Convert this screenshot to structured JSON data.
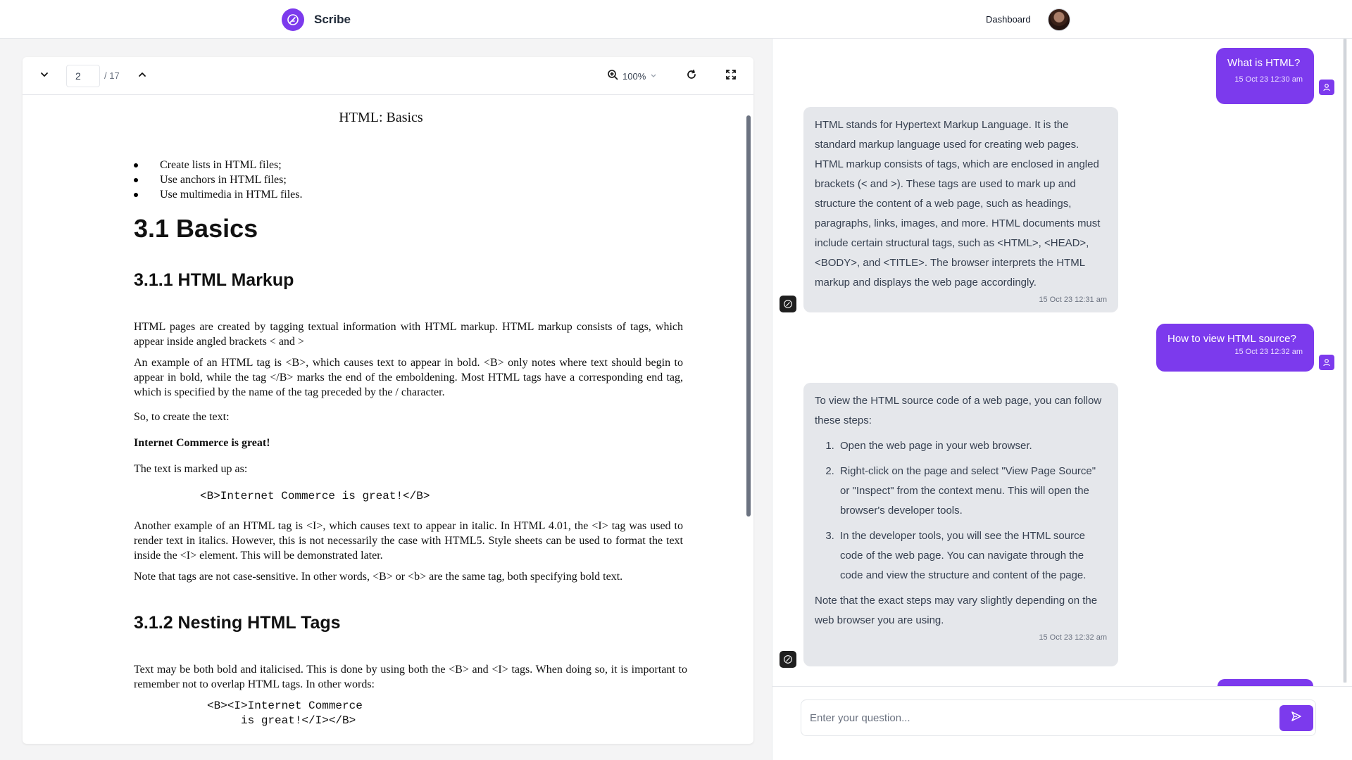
{
  "app": {
    "name": "Scribe"
  },
  "nav": {
    "dashboard_label": "Dashboard"
  },
  "viewer": {
    "page_current": "2",
    "page_total": "/ 17",
    "zoom": "100%"
  },
  "document": {
    "running_title": "HTML: Basics",
    "bullets": [
      "Create lists in HTML files;",
      "Use anchors in HTML files;",
      "Use multimedia in HTML files."
    ],
    "h1": "3.1  Basics",
    "h2_markup": "3.1.1 HTML Markup",
    "p1": "HTML pages are created by tagging textual information with HTML markup. HTML markup consists of tags, which appear inside angled brackets < and >",
    "p2": "An example of an HTML tag is <B>, which causes text to appear in bold. <B> only notes where text should begin to appear in bold, while the tag </B> marks the end of the emboldening. Most HTML tags have a corresponding end tag, which is specified by the name of the tag preceded by the / character.",
    "p3": "So, to create the  text:",
    "p4": "Internet Commerce is great!",
    "p5": "The text is marked up as:",
    "code1": "<B>Internet Commerce is great!</B>",
    "p6": "Another example of an HTML tag is <I>, which causes text to appear in italic. In HTML 4.01, the <I> tag was used to render text in italics. However, this is not necessarily the case with HTML5. Style sheets can be used to format the text inside the <I> element. This will be demonstrated later.",
    "p7": "Note that tags are not case-sensitive. In other words, <B> or <b> are the same tag, both specifying bold text.",
    "h2_nesting": "3.1.2 Nesting HTML Tags",
    "p8": "Text may be both bold and italicised. This is done by using both the <B> and <I> tags. When  doing so, it is important to remember not to overlap HTML tags. In other words:",
    "code2": "<B><I>Internet Commerce\n     is great!</I></B>"
  },
  "chat": {
    "messages": [
      {
        "role": "user",
        "text": "What is HTML?",
        "time": "15 Oct 23 12:30 am"
      },
      {
        "role": "assistant",
        "text": "HTML stands for Hypertext Markup Language. It is the standard markup language used for creating web pages. HTML markup consists of tags, which are enclosed in angled brackets (< and >). These tags are used to mark up and structure the content of a web page, such as headings, paragraphs, links, images, and more. HTML documents must include certain structural tags, such as <HTML>, <HEAD>, <BODY>, and <TITLE>. The browser interprets the HTML markup and displays the web page accordingly.",
        "time": "15 Oct 23 12:31 am"
      },
      {
        "role": "user",
        "text": "How to view HTML source?",
        "time": "15 Oct 23 12:32 am"
      },
      {
        "role": "assistant",
        "intro": "To view the HTML source code of a web page, you can follow these steps:",
        "steps": [
          "Open the web page in your web browser.",
          "Right-click on the page and select \"View Page Source\" or \"Inspect\" from the context menu. This will open the browser's developer tools.",
          "In the developer tools, you will see the HTML source code of the web page. You can navigate through the code and view the structure and content of the page."
        ],
        "outro": "Note that the exact steps may vary slightly depending on the web browser you are using.",
        "time": "15 Oct 23 12:32 am"
      }
    ],
    "input": {
      "placeholder": "Enter your question...",
      "value": ""
    }
  },
  "colors": {
    "accent": "#7c3aed",
    "bot_bubble": "#e5e7eb",
    "viewer_bg": "#f4f4f5"
  },
  "icons": [
    "quill-logo-icon",
    "chevron-down-icon",
    "chevron-up-icon",
    "zoom-in-icon",
    "refresh-icon",
    "fullscreen-icon",
    "user-icon",
    "send-icon"
  ]
}
